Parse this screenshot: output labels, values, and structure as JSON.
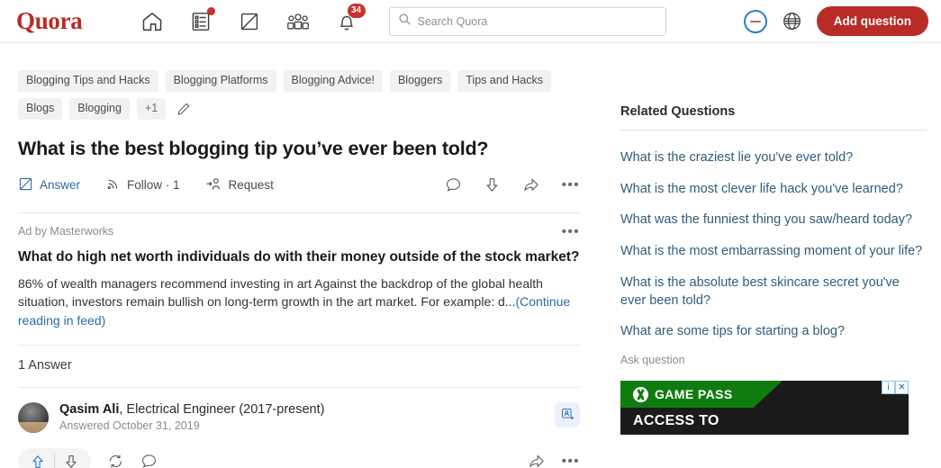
{
  "header": {
    "logo": "Quora",
    "nav": [
      {
        "name": "home-icon",
        "label": "Home",
        "badge": null
      },
      {
        "name": "answers-icon",
        "label": "Answers",
        "badge": "dot"
      },
      {
        "name": "write-icon",
        "label": "Write",
        "badge": null
      },
      {
        "name": "spaces-icon",
        "label": "Spaces",
        "badge": null
      },
      {
        "name": "notifications-icon",
        "label": "Notifications",
        "badge": "34"
      }
    ],
    "notification_count": "34",
    "search": {
      "placeholder": "Search Quora",
      "value": ""
    },
    "add_question_label": "Add question",
    "accent_red": "#b92b27",
    "accent_blue": "#2b81c4"
  },
  "topics": {
    "tags": [
      "Blogging Tips and Hacks",
      "Blogging Platforms",
      "Blogging Advice!",
      "Bloggers",
      "Tips and Hacks",
      "Blogs",
      "Blogging"
    ],
    "more_label": "+1",
    "edit_label": "Edit topics"
  },
  "question": {
    "title": "What is the best blogging tip you’ve ever been told?",
    "actions": {
      "answer_label": "Answer",
      "follow_label": "Follow",
      "follow_count": "1",
      "follow_display": "Follow · 1",
      "request_label": "Request",
      "more_label": "•••"
    }
  },
  "ad": {
    "by_label": "Ad by Masterworks",
    "more_label": "•••",
    "title": "What do high net worth individuals do with their money outside of the stock market?",
    "body": "86% of wealth managers recommend investing in art Against the backdrop of the global health situation, investors remain bullish on long-term growth in the art market. For example: d...",
    "cta": "(Continue reading in feed)"
  },
  "answers": {
    "count_label": "1 Answer",
    "items": [
      {
        "author": "Qasim Ali",
        "credential": ", Electrical Engineer (2017-present)",
        "date": "Answered October 31, 2019",
        "follow_user_label": "Follow user"
      }
    ],
    "action_labels": {
      "upvote": "Upvote",
      "downvote": "Downvote",
      "repost": "Repost",
      "comment": "Comment",
      "share": "Share",
      "more": "•••"
    }
  },
  "sidebar": {
    "title": "Related Questions",
    "questions": [
      "What is the craziest lie you've ever told?",
      "What is the most clever life hack you've learned?",
      "What was the funniest thing you saw/heard today?",
      "What is the most embarrassing moment of your life?",
      "What is the absolute best skincare secret you've ever been told?",
      "What are some tips for starting a blog?"
    ],
    "ask_question_label": "Ask question",
    "link_color": "#2f5d7c"
  },
  "side_ad": {
    "brand": "GAME PASS",
    "headline": "ACCESS TO",
    "adchoices_label": "i",
    "close_label": "✕",
    "brand_color": "#107c10"
  }
}
